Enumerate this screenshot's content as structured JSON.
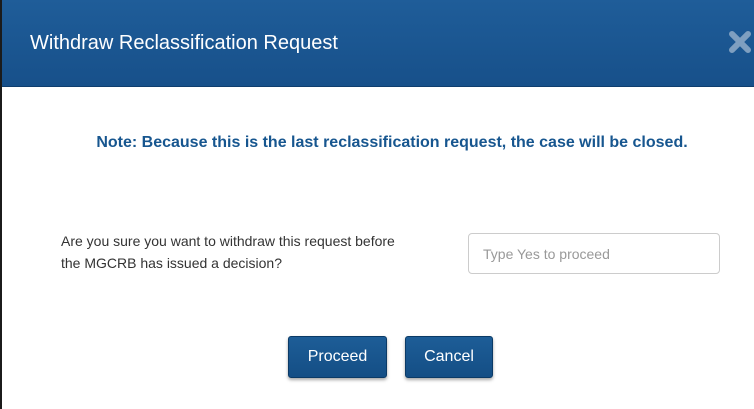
{
  "dialog": {
    "title": "Withdraw Reclassification Request",
    "close_icon": "close-x-icon",
    "note": "Note: Because this is the last reclassification request, the case will be closed.",
    "question": "Are you sure you want to withdraw this request before the MGCRB has issued a decision?",
    "confirm_input": {
      "value": "",
      "placeholder": "Type Yes to proceed"
    },
    "proceed_label": "Proceed",
    "cancel_label": "Cancel"
  },
  "colors": {
    "header_bg": "#1a5690",
    "note_text": "#17568f",
    "button_bg": "#17548c"
  }
}
